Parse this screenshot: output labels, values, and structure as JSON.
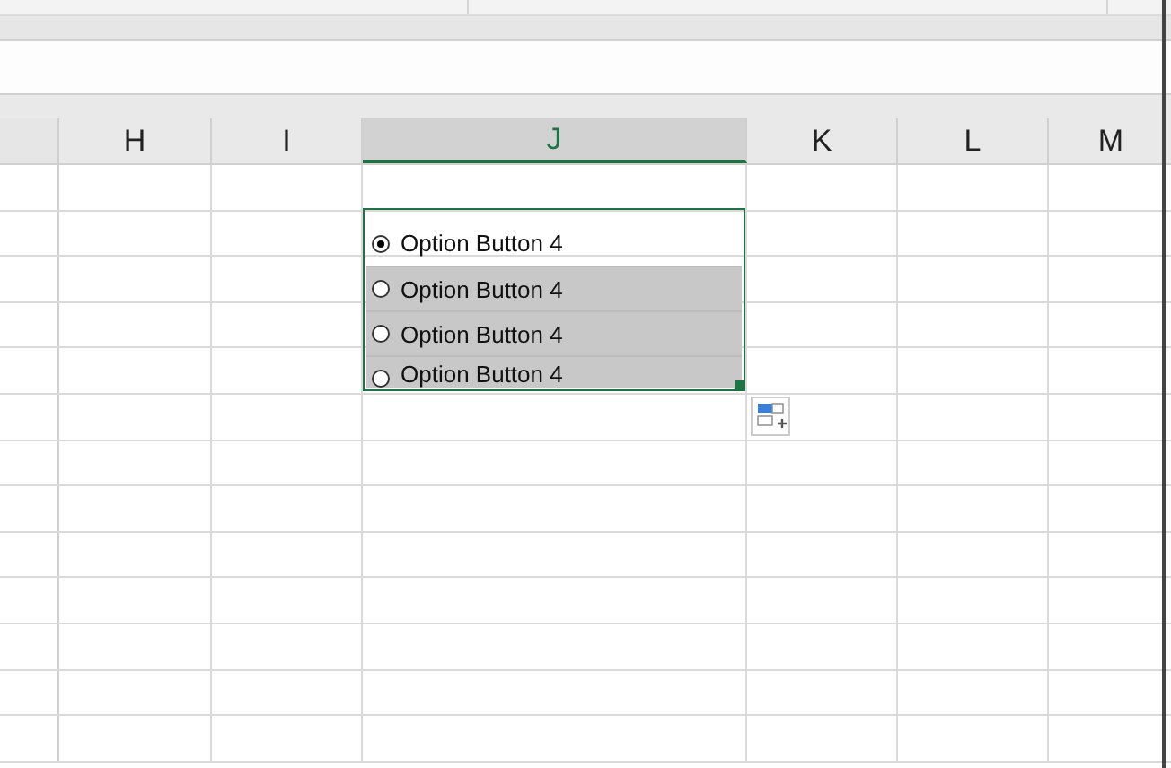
{
  "columns": [
    {
      "label": "H",
      "selected": false
    },
    {
      "label": "I",
      "selected": false
    },
    {
      "label": "J",
      "selected": true
    },
    {
      "label": "K",
      "selected": false
    },
    {
      "label": "L",
      "selected": false
    },
    {
      "label": "M",
      "selected": false
    }
  ],
  "option_buttons": [
    {
      "label": "Option Button 4",
      "selected": true,
      "highlighted": false
    },
    {
      "label": "Option Button 4",
      "selected": false,
      "highlighted": true
    },
    {
      "label": "Option Button 4",
      "selected": false,
      "highlighted": true
    },
    {
      "label": "Option Button 4",
      "selected": false,
      "highlighted": true
    }
  ]
}
